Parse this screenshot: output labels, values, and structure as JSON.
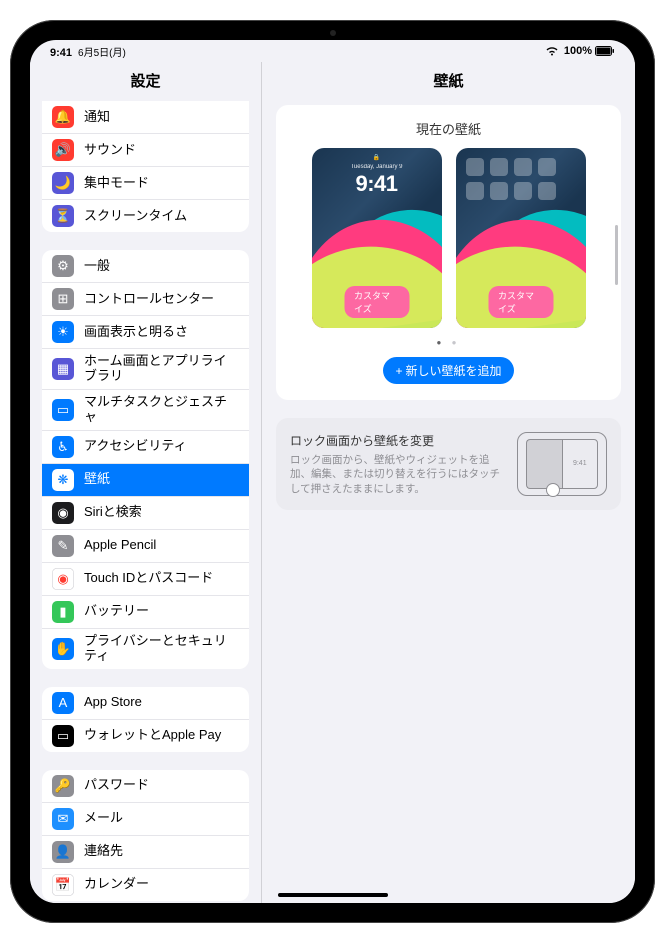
{
  "status": {
    "time": "9:41",
    "date": "6月5日(月)",
    "battery": "100%"
  },
  "sidebar": {
    "title": "設定",
    "g1": [
      {
        "label": "通知",
        "ico": "🔔",
        "bg": "#ff3b30"
      },
      {
        "label": "サウンド",
        "ico": "🔊",
        "bg": "#ff3b30"
      },
      {
        "label": "集中モード",
        "ico": "🌙",
        "bg": "#5856d6"
      },
      {
        "label": "スクリーンタイム",
        "ico": "⏳",
        "bg": "#5856d6"
      }
    ],
    "g2": [
      {
        "label": "一般",
        "ico": "⚙︎",
        "bg": "#8e8e93"
      },
      {
        "label": "コントロールセンター",
        "ico": "⊞",
        "bg": "#8e8e93"
      },
      {
        "label": "画面表示と明るさ",
        "ico": "☀︎",
        "bg": "#007aff"
      },
      {
        "label": "ホーム画面とアプリライブラリ",
        "ico": "▦",
        "bg": "#5856d6"
      },
      {
        "label": "マルチタスクとジェスチャ",
        "ico": "▭",
        "bg": "#007aff"
      },
      {
        "label": "アクセシビリティ",
        "ico": "♿︎",
        "bg": "#007aff"
      },
      {
        "label": "壁紙",
        "ico": "❋",
        "bg": "#00c7be",
        "selected": true
      },
      {
        "label": "Siriと検索",
        "ico": "◉",
        "bg": "#1c1c1e"
      },
      {
        "label": "Apple Pencil",
        "ico": "✎",
        "bg": "#8e8e93"
      },
      {
        "label": "Touch IDとパスコード",
        "ico": "◉",
        "bg": "#fff",
        "fg": "#ff3b30",
        "border": true
      },
      {
        "label": "バッテリー",
        "ico": "▮",
        "bg": "#34c759"
      },
      {
        "label": "プライバシーとセキュリティ",
        "ico": "✋",
        "bg": "#007aff"
      }
    ],
    "g3": [
      {
        "label": "App Store",
        "ico": "A",
        "bg": "#007aff"
      },
      {
        "label": "ウォレットとApple Pay",
        "ico": "▭",
        "bg": "#000"
      }
    ],
    "g4": [
      {
        "label": "パスワード",
        "ico": "🔑",
        "bg": "#8e8e93"
      },
      {
        "label": "メール",
        "ico": "✉︎",
        "bg": "#1e90ff"
      },
      {
        "label": "連絡先",
        "ico": "👤",
        "bg": "#8e8e93"
      },
      {
        "label": "カレンダー",
        "ico": "📅",
        "bg": "#fff",
        "border": true
      }
    ]
  },
  "detail": {
    "title": "壁紙",
    "current": "現在の壁紙",
    "customize": "カスタマイズ",
    "lockClock": "9:41",
    "lockDate": "Tuesday, January 9",
    "addNew": "新しい壁紙を追加",
    "plus": "+",
    "tipTitle": "ロック画面から壁紙を変更",
    "tipDesc": "ロック画面から、壁紙やウィジェットを追加、編集、または切り替えを行うにはタッチして押さえたままにします。",
    "tipClock": "9:41"
  }
}
